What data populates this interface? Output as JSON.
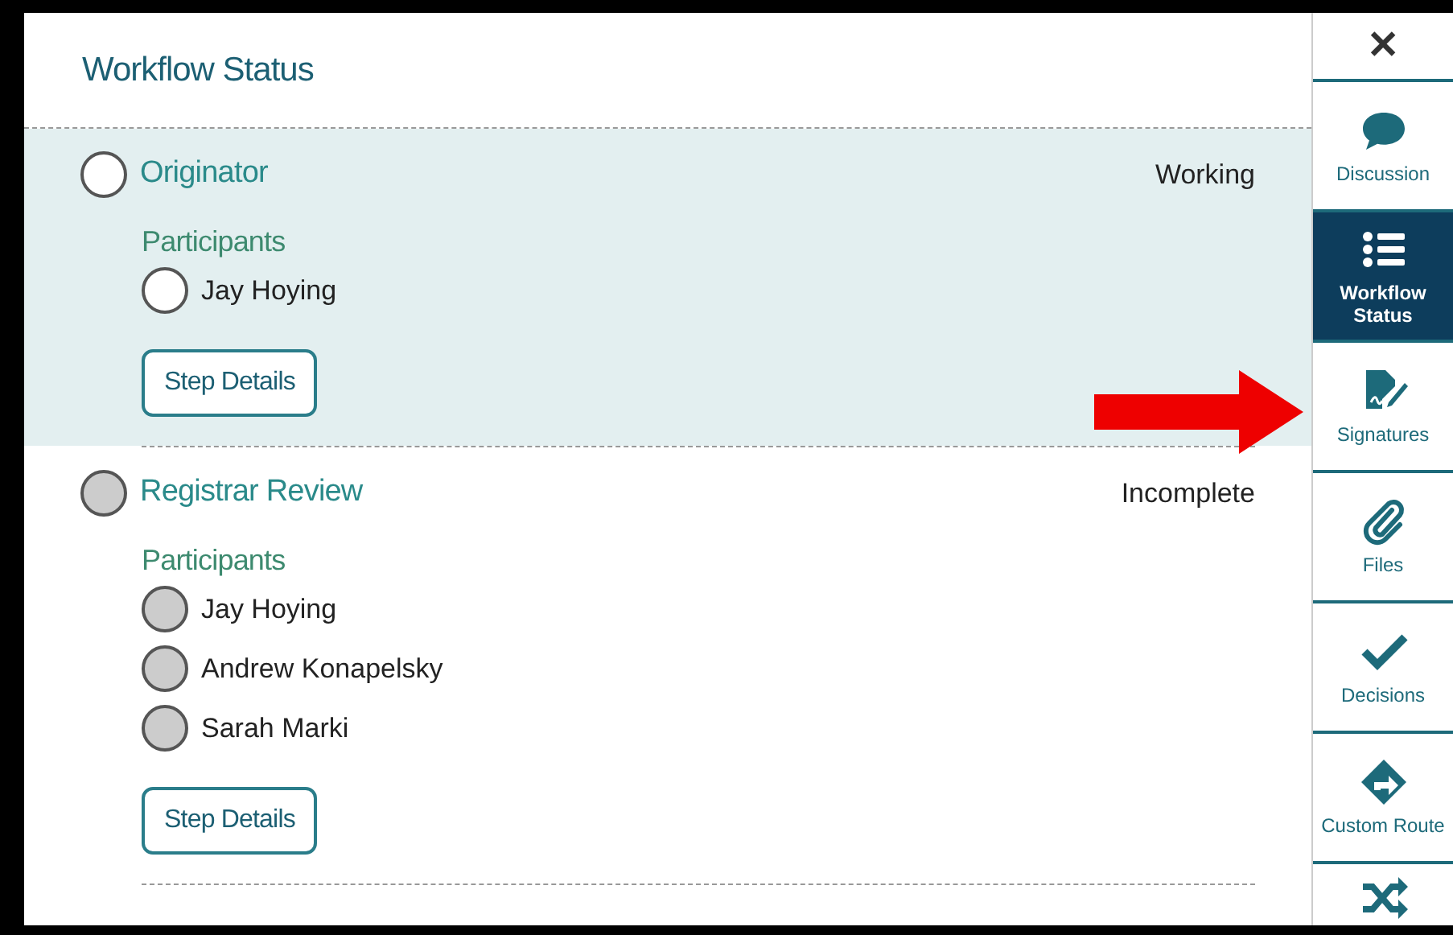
{
  "panel": {
    "title": "Workflow Status"
  },
  "steps": [
    {
      "name": "Originator",
      "status": "Working",
      "active": true,
      "participants_label": "Participants",
      "participants": [
        "Jay Hoying"
      ],
      "button": "Step Details"
    },
    {
      "name": "Registrar Review",
      "status": "Incomplete",
      "active": false,
      "participants_label": "Participants",
      "participants": [
        "Jay Hoying",
        "Andrew Konapelsky",
        "Sarah Marki"
      ],
      "button": "Step Details"
    }
  ],
  "sidebar": {
    "close": "✕",
    "tabs": [
      {
        "kind": "discussion",
        "label": "Discussion",
        "selected": false
      },
      {
        "kind": "list",
        "label": "Workflow Status",
        "selected": true
      },
      {
        "kind": "signature",
        "label": "Signatures",
        "selected": false
      },
      {
        "kind": "paperclip",
        "label": "Files",
        "selected": false
      },
      {
        "kind": "check",
        "label": "Decisions",
        "selected": false
      },
      {
        "kind": "route",
        "label": "Custom Route",
        "selected": false
      },
      {
        "kind": "shuffle",
        "selected": false
      }
    ]
  }
}
